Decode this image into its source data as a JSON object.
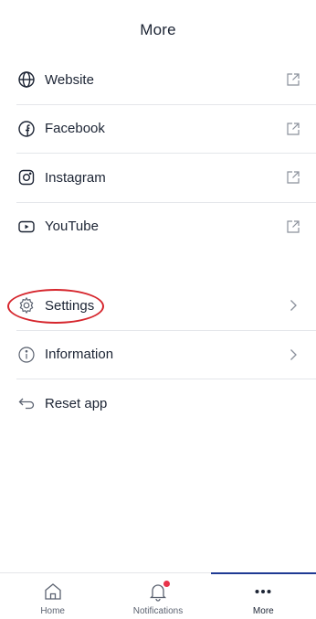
{
  "header": {
    "title": "More"
  },
  "social_links": [
    {
      "label": "Website",
      "icon": "globe-icon",
      "trail_icon": "external-link-icon"
    },
    {
      "label": "Facebook",
      "icon": "facebook-icon",
      "trail_icon": "external-link-icon"
    },
    {
      "label": "Instagram",
      "icon": "instagram-icon",
      "trail_icon": "external-link-icon"
    },
    {
      "label": "YouTube",
      "icon": "youtube-icon",
      "trail_icon": "external-link-icon"
    }
  ],
  "app_items": [
    {
      "label": "Settings",
      "icon": "gear-icon",
      "trail_icon": "chevron-right-icon",
      "highlighted": true
    },
    {
      "label": "Information",
      "icon": "info-icon",
      "trail_icon": "chevron-right-icon"
    },
    {
      "label": "Reset app",
      "icon": "undo-arrow-icon"
    }
  ],
  "tabbar": {
    "tabs": [
      {
        "label": "Home",
        "icon": "home-icon",
        "active": false
      },
      {
        "label": "Notifications",
        "icon": "bell-icon",
        "active": false,
        "badge": true
      },
      {
        "label": "More",
        "icon": "more-dots-icon",
        "active": true
      }
    ]
  },
  "colors": {
    "text": "#1c2434",
    "divider": "#e4e6ea",
    "accent": "#1f3a93",
    "badge": "#e8334a",
    "highlight": "#d6262d"
  }
}
